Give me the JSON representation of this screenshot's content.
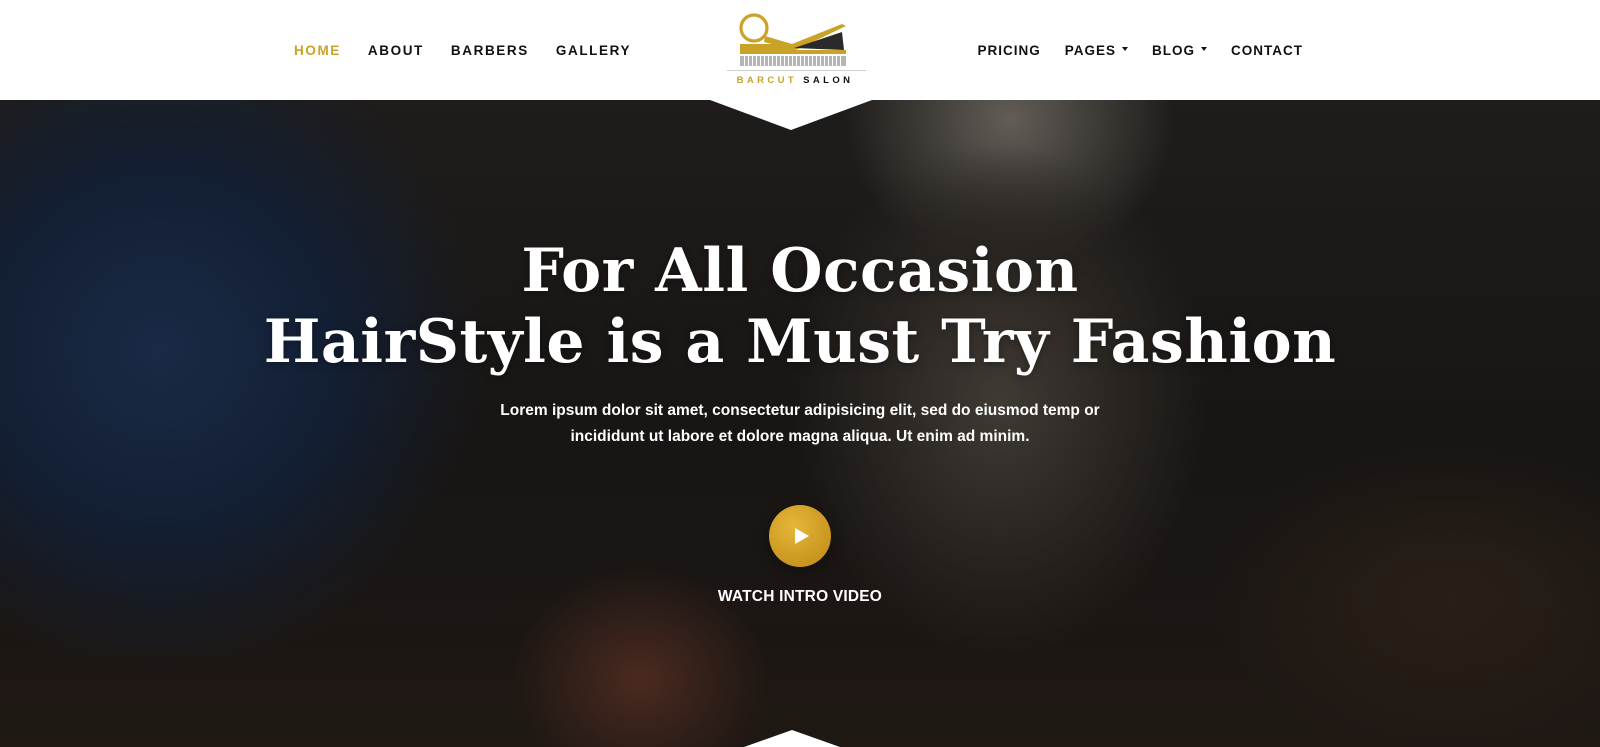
{
  "nav": {
    "left": [
      {
        "label": "HOME",
        "active": true
      },
      {
        "label": "ABOUT"
      },
      {
        "label": "BARBERS"
      },
      {
        "label": "GALLERY"
      }
    ],
    "right": [
      {
        "label": "PRICING"
      },
      {
        "label": "PAGES",
        "dropdown": true
      },
      {
        "label": "BLOG",
        "dropdown": true
      },
      {
        "label": "CONTACT"
      }
    ]
  },
  "logo": {
    "word1": "BARCUT",
    "word2": "SALON",
    "icon": "scissors-comb-icon"
  },
  "hero": {
    "title_line1": "For All Occasion",
    "title_line2": "HairStyle is a Must Try Fashion",
    "description": "Lorem ipsum dolor sit amet, consectetur adipisicing elit, sed do eiusmod temp or incididunt ut labore et dolore magna aliqua. Ut enim ad minim.",
    "cta_label": "WATCH INTRO VIDEO",
    "cta_icon": "play-icon"
  },
  "colors": {
    "accent": "#c9a227",
    "text_dark": "#111111",
    "header_bg": "#ffffff"
  }
}
